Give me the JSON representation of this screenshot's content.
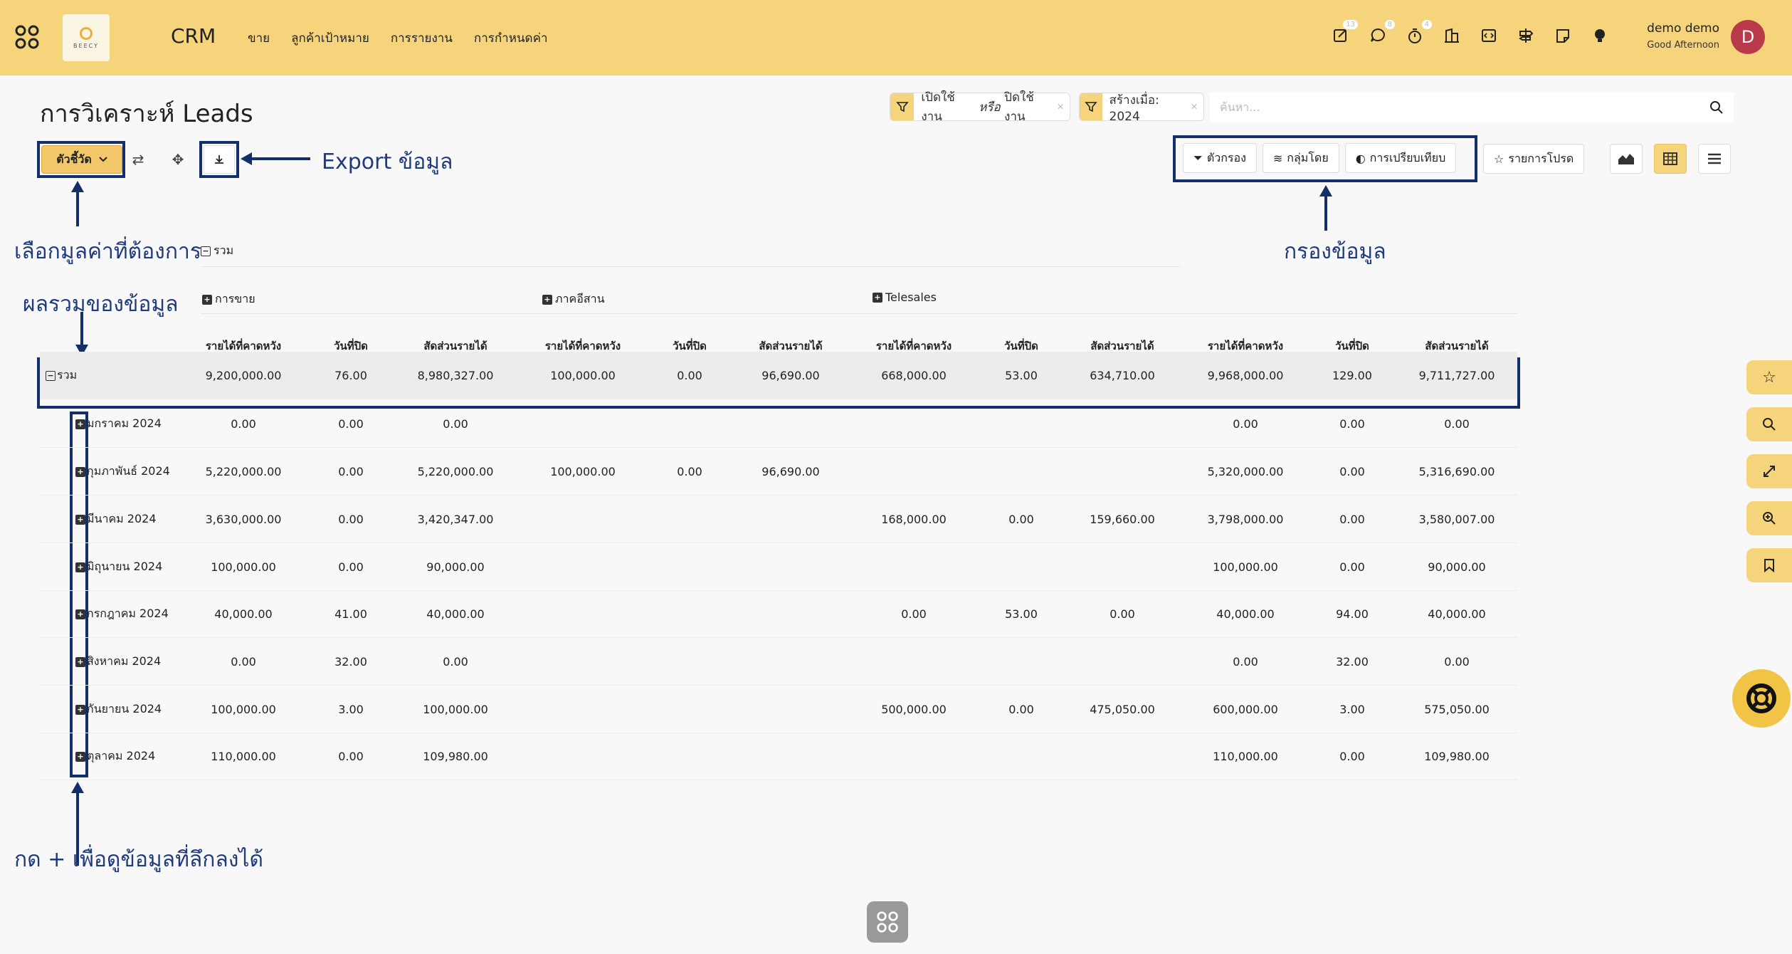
{
  "topbar": {
    "logo_text": "BEECY",
    "brand": "CRM",
    "nav": [
      "ขาย",
      "ลูกค้าเป้าหมาย",
      "การรายงาน",
      "การกำหนดค่า"
    ],
    "badges": {
      "activity": "13",
      "chat": "8",
      "timer": "4"
    },
    "user_name": "demo demo",
    "user_greeting": "Good Afternoon",
    "avatar_letter": "D"
  },
  "page": {
    "title": "การวิเคราะห์ Leads"
  },
  "filters": {
    "chip1_a": "เปิดใช้งาน",
    "chip1_or": "หรือ",
    "chip1_b": "ปิดใช้งาน",
    "chip2": "สร้างเมื่อ: 2024",
    "search_placeholder": "ค้นหา..."
  },
  "toolbar": {
    "measures_label": "ตัวชี้วัด",
    "filter_label": "ตัวกรอง",
    "group_label": "กลุ่มโดย",
    "compare_label": "การเปรียบเทียบ",
    "favorites_label": "รายการโปรด"
  },
  "annotations": {
    "export": "Export ข้อมูล",
    "measures": "เลือกมูลค่าที่ต้องการ",
    "filters": "กรองข้อมูล",
    "total": "ผลรวมของข้อมูล",
    "expand": "กด + เพื่อดูข้อมูลที่ลึกลงได้"
  },
  "pivot": {
    "total_header": "รวม",
    "groups": [
      "การขาย",
      "ภาคอีสาน",
      "Telesales"
    ],
    "measure_headers": [
      "รายได้ที่คาดหวัง",
      "วันที่ปิด",
      "สัดส่วนรายได้"
    ],
    "total_row": {
      "label": "รวม",
      "cells": [
        "9,200,000.00",
        "76.00",
        "8,980,327.00",
        "100,000.00",
        "0.00",
        "96,690.00",
        "668,000.00",
        "53.00",
        "634,710.00",
        "9,968,000.00",
        "129.00",
        "9,711,727.00"
      ]
    },
    "rows": [
      {
        "label": "มกราคม 2024",
        "cells": [
          "0.00",
          "0.00",
          "0.00",
          "",
          "",
          "",
          "",
          "",
          "",
          "0.00",
          "0.00",
          "0.00"
        ]
      },
      {
        "label": "กุมภาพันธ์ 2024",
        "cells": [
          "5,220,000.00",
          "0.00",
          "5,220,000.00",
          "100,000.00",
          "0.00",
          "96,690.00",
          "",
          "",
          "",
          "5,320,000.00",
          "0.00",
          "5,316,690.00"
        ]
      },
      {
        "label": "มีนาคม 2024",
        "cells": [
          "3,630,000.00",
          "0.00",
          "3,420,347.00",
          "",
          "",
          "",
          "168,000.00",
          "0.00",
          "159,660.00",
          "3,798,000.00",
          "0.00",
          "3,580,007.00"
        ]
      },
      {
        "label": "มิถุนายน 2024",
        "cells": [
          "100,000.00",
          "0.00",
          "90,000.00",
          "",
          "",
          "",
          "",
          "",
          "",
          "100,000.00",
          "0.00",
          "90,000.00"
        ]
      },
      {
        "label": "กรกฎาคม 2024",
        "cells": [
          "40,000.00",
          "41.00",
          "40,000.00",
          "",
          "",
          "",
          "0.00",
          "53.00",
          "0.00",
          "40,000.00",
          "94.00",
          "40,000.00"
        ]
      },
      {
        "label": "สิงหาคม 2024",
        "cells": [
          "0.00",
          "32.00",
          "0.00",
          "",
          "",
          "",
          "",
          "",
          "",
          "0.00",
          "32.00",
          "0.00"
        ]
      },
      {
        "label": "กันยายน 2024",
        "cells": [
          "100,000.00",
          "3.00",
          "100,000.00",
          "",
          "",
          "",
          "500,000.00",
          "0.00",
          "475,050.00",
          "600,000.00",
          "3.00",
          "575,050.00"
        ]
      },
      {
        "label": "ตุลาคม 2024",
        "cells": [
          "110,000.00",
          "0.00",
          "109,980.00",
          "",
          "",
          "",
          "",
          "",
          "",
          "110,000.00",
          "0.00",
          "109,980.00"
        ]
      }
    ]
  },
  "colors": {
    "topbar": "#f6d47c",
    "annotation": "#132e6b",
    "avatar": "#b83a4b"
  }
}
